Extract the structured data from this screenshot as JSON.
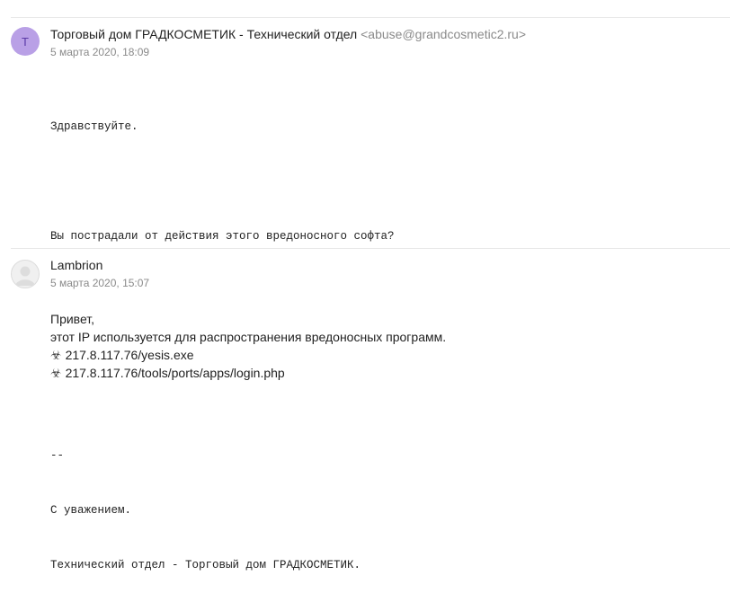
{
  "messages": [
    {
      "avatar_letter": "T",
      "sender_name": "Торговый дом ГРАДКОСМЕТИК - Технический отдел",
      "sender_email": "<abuse@grandcosmetic2.ru>",
      "date": "5 марта 2020, 18:09",
      "body_lines": [
        "Здравствуйте.",
        "",
        "Вы пострадали от действия этого вредоносного софта?",
        "",
        "",
        "",
        "--",
        "С уважением.",
        "Технический отдел - Торговый дом ГРАДКОСМЕТИК."
      ]
    },
    {
      "sender_name": "Lambrion",
      "date": "5 марта 2020, 15:07",
      "greeting": "Привет,",
      "line2": "этот IP используется для распространения вредоносных программ.",
      "link1": "217.8.117.76/yesis.exe",
      "link2": "217.8.117.76/tools/ports/apps/login.php",
      "biohazard_glyph": "☣"
    }
  ]
}
